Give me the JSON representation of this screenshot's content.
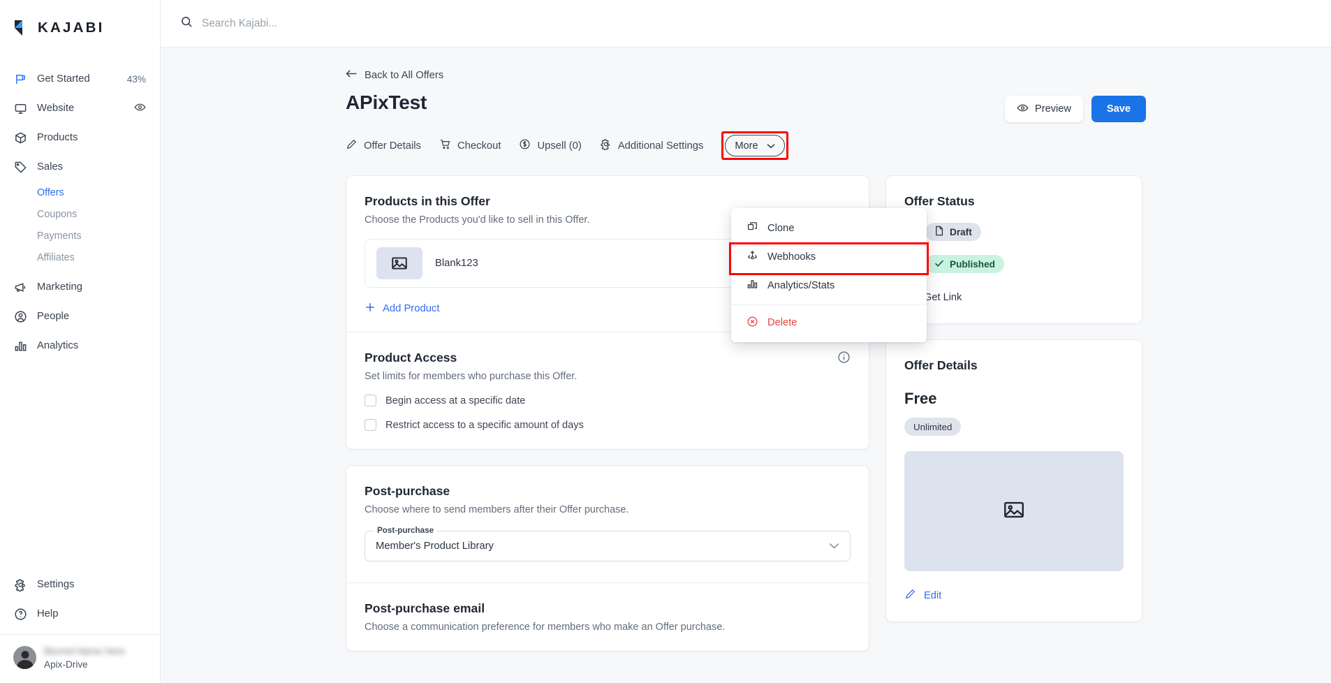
{
  "brand": {
    "name": "KAJABI",
    "logo_icon": "kajabi-logo-icon"
  },
  "sidebar": {
    "items": [
      {
        "label": "Get Started",
        "icon": "flag-icon",
        "meta": "43%"
      },
      {
        "label": "Website",
        "icon": "monitor-icon",
        "meta": "eye-icon"
      },
      {
        "label": "Products",
        "icon": "box-icon",
        "meta": ""
      },
      {
        "label": "Sales",
        "icon": "tag-icon",
        "meta": ""
      }
    ],
    "sub_items": [
      {
        "label": "Offers",
        "active": true
      },
      {
        "label": "Coupons",
        "active": false
      },
      {
        "label": "Payments",
        "active": false
      },
      {
        "label": "Affiliates",
        "active": false
      }
    ],
    "items_after": [
      {
        "label": "Marketing",
        "icon": "megaphone-icon",
        "meta": ""
      },
      {
        "label": "People",
        "icon": "person-circle-icon",
        "meta": ""
      },
      {
        "label": "Analytics",
        "icon": "bar-chart-icon",
        "meta": ""
      }
    ],
    "bottom_items": [
      {
        "label": "Settings",
        "icon": "gear-icon"
      },
      {
        "label": "Help",
        "icon": "question-circle-icon"
      }
    ],
    "user": {
      "name": "",
      "account": "Apix-Drive"
    }
  },
  "topbar": {
    "search_placeholder": "Search Kajabi...",
    "search_value": "",
    "search_icon": "search-icon"
  },
  "page": {
    "back_label": "Back to All Offers",
    "back_icon": "arrow-left-icon",
    "title": "APixTest",
    "preview_label": "Preview",
    "preview_icon": "eye-icon",
    "save_label": "Save"
  },
  "tabs": [
    {
      "label": "Offer Details",
      "icon": "pencil-icon"
    },
    {
      "label": "Checkout",
      "icon": "cart-icon"
    },
    {
      "label": "Upsell (0)",
      "icon": "dollar-circle-icon"
    },
    {
      "label": "Additional Settings",
      "icon": "gear-icon"
    }
  ],
  "more": {
    "label": "More",
    "chevron_icon": "chevron-down-icon",
    "highlighted": true
  },
  "dropdown": {
    "items": [
      {
        "label": "Clone",
        "icon": "copy-icon",
        "highlighted": false,
        "danger": false
      },
      {
        "label": "Webhooks",
        "icon": "webhook-icon",
        "highlighted": true,
        "danger": false
      },
      {
        "label": "Analytics/Stats",
        "icon": "bar-chart-icon",
        "highlighted": false,
        "danger": false
      },
      {
        "label": "Delete",
        "icon": "delete-circle-icon",
        "highlighted": false,
        "danger": true
      }
    ]
  },
  "products_card": {
    "title": "Products in this Offer",
    "subtitle": "Choose the Products you'd like to sell in this Offer.",
    "product": {
      "name": "Blank123",
      "thumb_icon": "image-placeholder-icon",
      "remove_icon": "close-icon"
    },
    "add_label": "Add Product",
    "add_icon": "plus-icon"
  },
  "product_access": {
    "title": "Product Access",
    "subtitle": "Set limits for members who purchase this Offer.",
    "info_icon": "info-icon",
    "checkboxes": [
      {
        "label": "Begin access at a specific date",
        "checked": false
      },
      {
        "label": "Restrict access to a specific amount of days",
        "checked": false
      }
    ]
  },
  "post_purchase": {
    "title": "Post-purchase",
    "subtitle": "Choose where to send members after their Offer purchase.",
    "field_legend": "Post-purchase",
    "field_value": "Member's Product Library",
    "chevron_icon": "chevron-down-icon"
  },
  "post_purchase_email": {
    "title": "Post-purchase email",
    "subtitle": "Choose a communication preference for members who make an Offer purchase."
  },
  "offer_status": {
    "title": "Offer Status",
    "options": [
      {
        "label": "Draft",
        "icon": "document-icon",
        "selected": false
      },
      {
        "label": "Published",
        "icon": "check-icon",
        "selected": true
      }
    ],
    "get_link_label": "Get Link",
    "get_link_icon": "link-icon"
  },
  "offer_details": {
    "title": "Offer Details",
    "price": "Free",
    "tag": "Unlimited",
    "image_icon": "image-placeholder-icon",
    "edit_label": "Edit",
    "edit_icon": "pencil-icon"
  },
  "colors": {
    "accent": "#1b73e8",
    "link": "#2f6fed",
    "danger": "#e8423f",
    "highlight": "#ff0000",
    "published_bg": "#c9f3e0",
    "draft_bg": "#dfe3eb",
    "page_bg": "#f7f8fa"
  }
}
